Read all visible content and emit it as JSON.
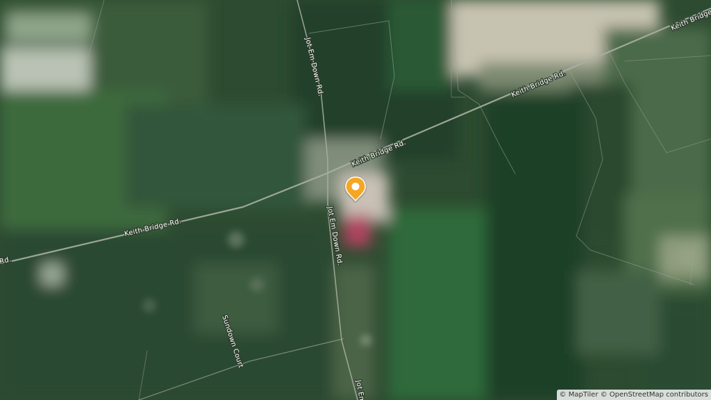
{
  "map": {
    "style": "satellite",
    "roads": {
      "keith_bridge_rd": "Keith Bridge Rd.",
      "keith_bridge_rd_partial_left": "Rd.",
      "keith_bridge_rd_partial_right": "Keith Bridge",
      "jot_em_down_rd": "Jot Em Down Rd.",
      "jot_em_partial": "Jot Em",
      "sundown_court": "Sundown Court"
    },
    "marker": {
      "type": "location-pin",
      "color": "#f5a623"
    }
  },
  "attribution": {
    "maptiler": "© MapTiler",
    "osm": "© OpenStreetMap contributors"
  }
}
